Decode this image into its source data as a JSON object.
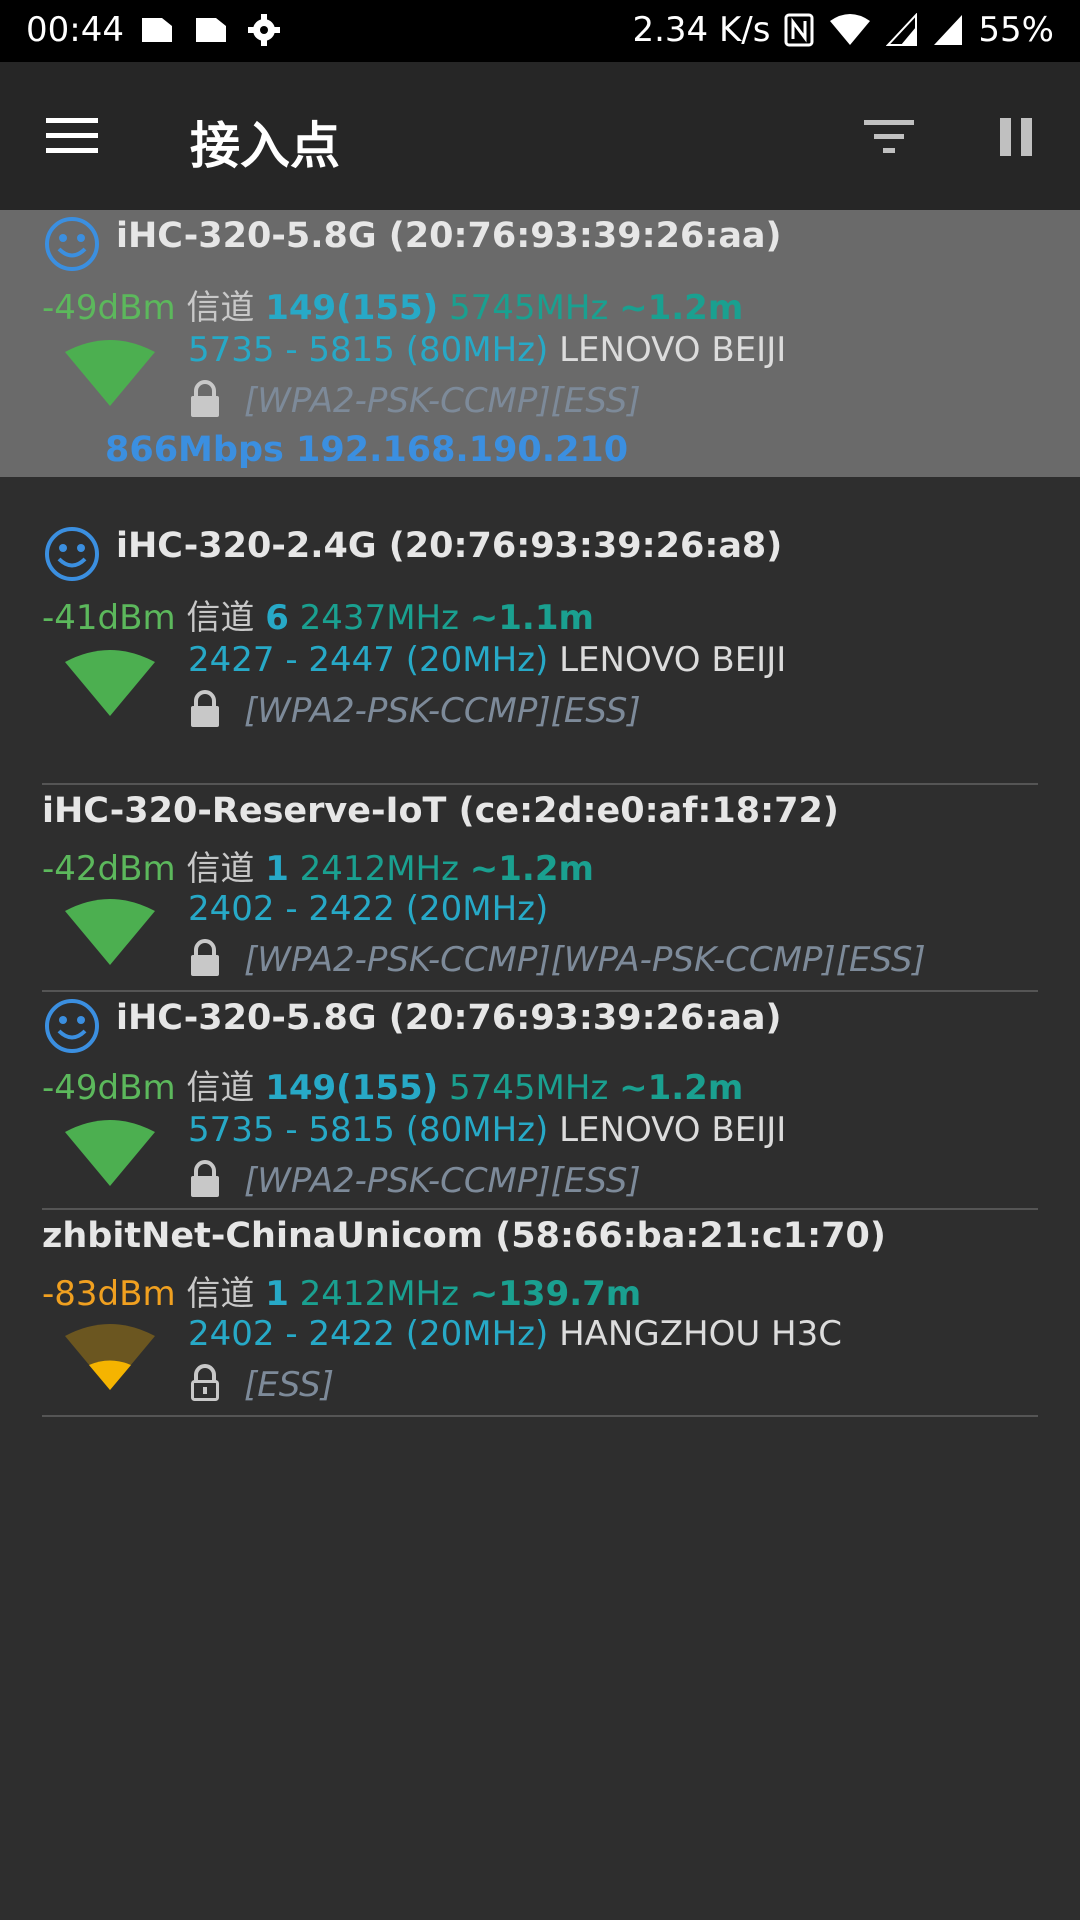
{
  "status_bar": {
    "time": "00:44",
    "speed": "2.34 K/s",
    "battery": "55%",
    "icons": [
      "file-icon",
      "file-icon",
      "settings-gear-icon",
      "nfc-icon",
      "wifi-status-icon",
      "signal-icon",
      "signal-icon"
    ]
  },
  "app_bar": {
    "title": "接入点",
    "icons": [
      "menu-icon",
      "filter-icon",
      "pause-icon"
    ]
  },
  "colors": {
    "green": "#5cb85c",
    "yellow": "#f5b400",
    "blue": "#3b8fe0",
    "cyan": "#27a9c7",
    "teal": "#1aa090"
  },
  "access_points": [
    {
      "ssid_line": "iHC-320-5.8G (20:76:93:39:26:aa)",
      "connected_icon": true,
      "signal": "-49dBm",
      "channel_label": "信道",
      "channel": "149(155)",
      "freq": "5745MHz",
      "distance": "~1.2m",
      "range": "5735 - 5815 (80MHz)",
      "vendor": "LENOVO BEIJI",
      "security": "[WPA2-PSK-CCMP][ESS]",
      "locked": true,
      "link_info": "866Mbps 192.168.190.210",
      "selected": true,
      "strength": 1.0
    },
    {
      "ssid_line": "iHC-320-2.4G (20:76:93:39:26:a8)",
      "connected_icon": true,
      "signal": "-41dBm",
      "channel_label": "信道",
      "channel": "6",
      "freq": "2437MHz",
      "distance": "~1.1m",
      "range": "2427 - 2447 (20MHz)",
      "vendor": "LENOVO BEIJI",
      "security": "[WPA2-PSK-CCMP][ESS]",
      "locked": true,
      "strength": 1.0
    },
    {
      "ssid_line": "iHC-320-Reserve-IoT (ce:2d:e0:af:18:72)",
      "connected_icon": false,
      "signal": "-42dBm",
      "channel_label": "信道",
      "channel": "1",
      "freq": "2412MHz",
      "distance": "~1.2m",
      "range": "2402 - 2422 (20MHz)",
      "vendor": "",
      "security": "[WPA2-PSK-CCMP][WPA-PSK-CCMP][ESS]",
      "locked": true,
      "strength": 1.0
    },
    {
      "ssid_line": "iHC-320-5.8G (20:76:93:39:26:aa)",
      "connected_icon": true,
      "signal": "-49dBm",
      "channel_label": "信道",
      "channel": "149(155)",
      "freq": "5745MHz",
      "distance": "~1.2m",
      "range": "5735 - 5815 (80MHz)",
      "vendor": "LENOVO BEIJI",
      "security": "[WPA2-PSK-CCMP][ESS]",
      "locked": true,
      "strength": 1.0
    },
    {
      "ssid_line": "zhbitNet-ChinaUnicom (58:66:ba:21:c1:70)",
      "connected_icon": false,
      "signal": "-83dBm",
      "channel_label": "信道",
      "channel": "1",
      "freq": "2412MHz",
      "distance": "~139.7m",
      "range": "2402 - 2422 (20MHz)",
      "vendor": "HANGZHOU H3C",
      "security": "[ESS]",
      "locked": false,
      "strength": 0.25
    }
  ]
}
